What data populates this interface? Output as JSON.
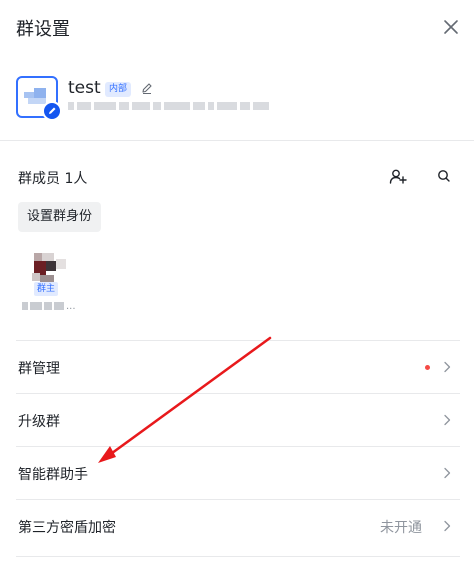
{
  "header": {
    "title": "群设置"
  },
  "group": {
    "name": "test",
    "tag": "内部"
  },
  "members": {
    "label": "群成员 1人",
    "set_identity_label": "设置群身份",
    "owner_badge": "群主",
    "name_suffix": "..."
  },
  "settings": [
    {
      "label": "群管理",
      "has_dot": true,
      "status": ""
    },
    {
      "label": "升级群",
      "has_dot": false,
      "status": ""
    },
    {
      "label": "智能群助手",
      "has_dot": false,
      "status": ""
    },
    {
      "label": "第三方密盾加密",
      "has_dot": false,
      "status": "未开通"
    }
  ],
  "colors": {
    "accent": "#3370ff",
    "dot": "#f54a45",
    "annotation_arrow": "#e8191c"
  },
  "icons": {
    "close": "close-icon",
    "edit": "pencil-icon",
    "add_member": "add-user-icon",
    "search": "search-icon",
    "chevron": "chevron-right-icon"
  }
}
